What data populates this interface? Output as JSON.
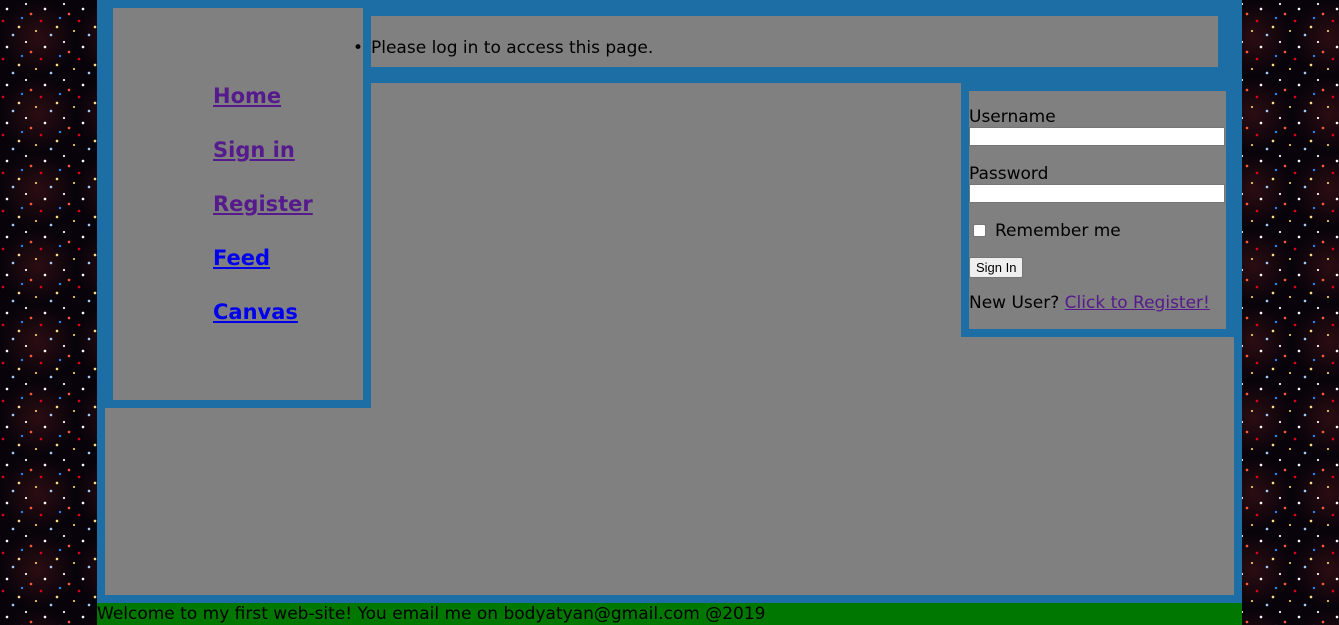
{
  "nav": {
    "items": [
      {
        "label": "Home"
      },
      {
        "label": "Sign in"
      },
      {
        "label": "Register"
      },
      {
        "label": "Feed"
      },
      {
        "label": "Canvas"
      }
    ]
  },
  "messages": [
    "Please log in to access this page."
  ],
  "login": {
    "username_label": "Username",
    "username_value": "",
    "password_label": "Password",
    "password_value": "",
    "remember_label": "Remember me",
    "remember_checked": false,
    "submit_label": "Sign In",
    "new_user_text": "New User?",
    "register_link": "Click to Register!"
  },
  "footer": {
    "text": "Welcome to my first web-site! You email me on bodyatyan@gmail.com @2019"
  },
  "colors": {
    "frame": "#1c6ea4",
    "panel": "#808080",
    "footer": "#007800",
    "visited_link": "#551a8b",
    "link": "#0000ee"
  }
}
